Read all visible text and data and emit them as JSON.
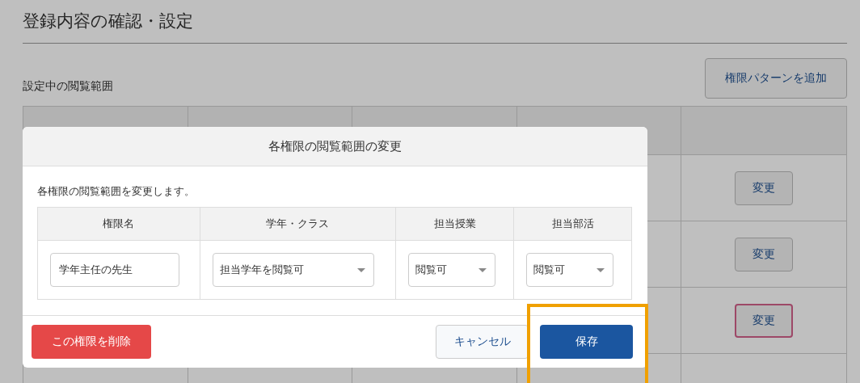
{
  "page": {
    "title": "登録内容の確認・設定",
    "section_label": "設定中の閲覧範囲",
    "add_button": "権限パターンを追加"
  },
  "table": {
    "rows": [
      {
        "action": "変更",
        "focused": false
      },
      {
        "action": "変更",
        "focused": false
      },
      {
        "action": "変更",
        "focused": true
      }
    ]
  },
  "modal": {
    "title": "各権限の閲覧範囲の変更",
    "description": "各権限の閲覧範囲を変更します。",
    "columns": [
      "権限名",
      "学年・クラス",
      "担当授業",
      "担当部活"
    ],
    "fields": [
      {
        "kind": "text",
        "value": "学年主任の先生"
      },
      {
        "kind": "select",
        "value": "担当学年を閲覧可"
      },
      {
        "kind": "select",
        "value": "閲覧可"
      },
      {
        "kind": "select",
        "value": "閲覧可"
      }
    ],
    "delete_button": "この権限を削除",
    "cancel_button": "キャンセル",
    "save_button": "保存",
    "save_highlighted": true
  }
}
